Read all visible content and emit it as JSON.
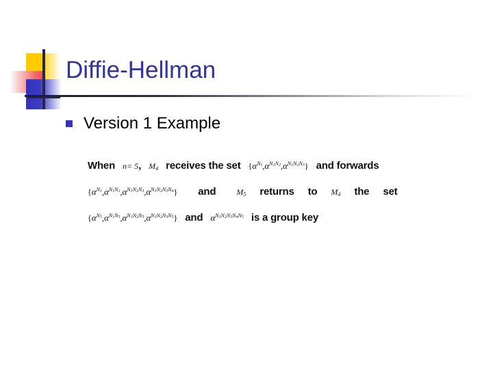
{
  "slide": {
    "title": "Diffie-Hellman",
    "bullet": "Version 1 Example",
    "bullet_marker": "square-bullet",
    "colors": {
      "title": "#333399",
      "bullet_marker": "#3333bb",
      "logo_yellow": "#ffcc00",
      "logo_red": "#f04a4a",
      "logo_blue": "#3333bb",
      "crosshair": "#26264a",
      "rule": "#1c1c2e",
      "body_text": "#111111",
      "background": "#ffffff"
    }
  },
  "body": {
    "line1": {
      "w_when": "When",
      "var_n": "n",
      "var_n_value": "= 5",
      "comma": ",",
      "var_m4": "M",
      "var_m4_sub": "4",
      "w_receives_the_set": "receives  the  set",
      "set": {
        "open": "{",
        "terms": [
          {
            "base": "α",
            "exp": [
              "N",
              "1"
            ]
          },
          {
            "base": "α",
            "exp": [
              "N",
              "1",
              "N",
              "2"
            ]
          },
          {
            "base": "α",
            "exp": [
              "N",
              "1",
              "N",
              "2",
              "N",
              "3"
            ]
          }
        ],
        "close": "}"
      },
      "w_and_forwards": "and forwards"
    },
    "line2": {
      "set": {
        "open": "{",
        "terms": [
          {
            "base": "α",
            "exp": [
              "N",
              "1"
            ]
          },
          {
            "base": "α",
            "exp": [
              "N",
              "1",
              "N",
              "2"
            ]
          },
          {
            "base": "α",
            "exp": [
              "N",
              "1",
              "N",
              "2",
              "N",
              "3"
            ]
          },
          {
            "base": "α",
            "exp": [
              "N",
              "1",
              "N",
              "2",
              "N",
              "3",
              "N",
              "4"
            ]
          }
        ],
        "close": "}"
      },
      "w_and": "and",
      "var_m5": "M",
      "var_m5_sub": "5",
      "w_returns": "returns",
      "w_to": "to",
      "var_m4": "M",
      "var_m4_sub": "4",
      "w_the": "the",
      "w_set": "set"
    },
    "line3": {
      "set": {
        "open": "{",
        "terms": [
          {
            "base": "α",
            "exp": [
              "N",
              "5"
            ]
          },
          {
            "base": "α",
            "exp": [
              "N",
              "1",
              "N",
              "5"
            ]
          },
          {
            "base": "α",
            "exp": [
              "N",
              "1",
              "N",
              "2",
              "N",
              "5"
            ]
          },
          {
            "base": "α",
            "exp": [
              "N",
              "1",
              "N",
              "2",
              "N",
              "3",
              "N",
              "5"
            ]
          }
        ],
        "close": "}"
      },
      "w_and": "and",
      "key": {
        "base": "α",
        "exp": [
          "N",
          "1",
          "N",
          "2",
          "N",
          "3",
          "N",
          "4",
          "N",
          "5"
        ]
      },
      "w_is_a_group_key": "is a group key"
    }
  }
}
